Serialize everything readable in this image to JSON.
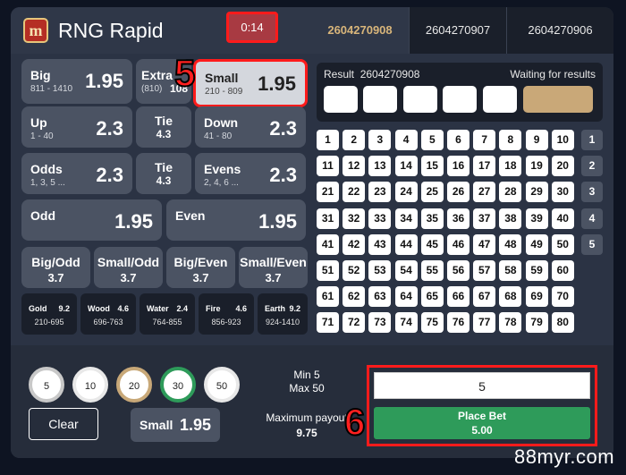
{
  "header": {
    "logo_glyph": "m",
    "title": "RNG Rapid",
    "timer": "0:14",
    "tabs": [
      "2604270908",
      "2604270907",
      "2604270906"
    ]
  },
  "bets": {
    "big": {
      "name": "Big",
      "range": "811 - 1410",
      "odds": "1.95"
    },
    "extra": {
      "name": "Extra",
      "range": "(810)",
      "odds": "108"
    },
    "small": {
      "name": "Small",
      "range": "210 - 809",
      "odds": "1.95"
    },
    "up": {
      "name": "Up",
      "range": "1 - 40",
      "odds": "2.3"
    },
    "tie1": {
      "name": "Tie",
      "odds": "4.3"
    },
    "down": {
      "name": "Down",
      "range": "41 - 80",
      "odds": "2.3"
    },
    "odds": {
      "name": "Odds",
      "range": "1, 3, 5 ...",
      "odds": "2.3"
    },
    "tie2": {
      "name": "Tie",
      "odds": "4.3"
    },
    "evens": {
      "name": "Evens",
      "range": "2, 4, 6 ...",
      "odds": "2.3"
    },
    "odd": {
      "name": "Odd",
      "odds": "1.95"
    },
    "even": {
      "name": "Even",
      "odds": "1.95"
    },
    "combos": [
      {
        "name": "Big/Odd",
        "odds": "3.7"
      },
      {
        "name": "Small/Odd",
        "odds": "3.7"
      },
      {
        "name": "Big/Even",
        "odds": "3.7"
      },
      {
        "name": "Small/Even",
        "odds": "3.7"
      }
    ],
    "elements": [
      {
        "name": "Gold",
        "odds": "9.2",
        "range": "210-695"
      },
      {
        "name": "Wood",
        "odds": "4.6",
        "range": "696-763"
      },
      {
        "name": "Water",
        "odds": "2.4",
        "range": "764-855"
      },
      {
        "name": "Fire",
        "odds": "4.6",
        "range": "856-923"
      },
      {
        "name": "Earth",
        "odds": "9.2",
        "range": "924-1410"
      }
    ]
  },
  "annotations": {
    "five": "5",
    "six": "6"
  },
  "result": {
    "label": "Result",
    "draw": "2604270908",
    "status": "Waiting for results"
  },
  "row_selectors": [
    "1",
    "2",
    "3",
    "4",
    "5"
  ],
  "bet_panel": {
    "chips": [
      "5",
      "10",
      "20",
      "30",
      "50"
    ],
    "chip_colors": [
      "#ffffff",
      "#ffffff",
      "#c8a878",
      "#2e9b5a",
      "#ffffff"
    ],
    "clear_label": "Clear",
    "selected_bet": "Small",
    "selected_odds": "1.95",
    "min_label": "Min 5",
    "max_label": "Max 50",
    "max_payout_label": "Maximum payout",
    "max_payout_value": "9.75",
    "amount": "5",
    "place_label": "Place Bet",
    "place_amount": "5.00"
  },
  "watermark": "88myr.com",
  "colors": {
    "accent_gold": "#d8b57a",
    "highlight_red": "#ff1b1b",
    "place_green": "#2e9b5a"
  }
}
